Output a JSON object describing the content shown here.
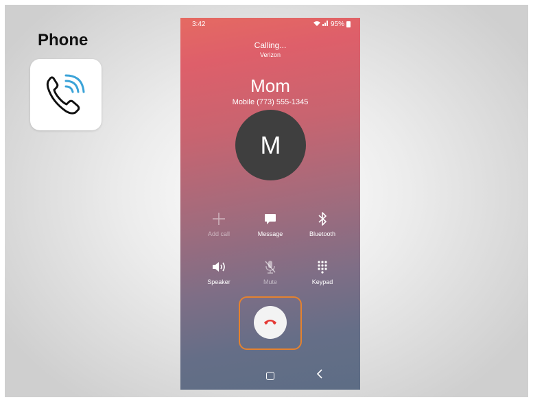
{
  "slide": {
    "title": "Phone"
  },
  "status": {
    "time": "3:42",
    "battery": "95%"
  },
  "call": {
    "state": "Calling...",
    "carrier": "Verizon",
    "contact_name": "Mom",
    "number_label": "Mobile  (773) 555-1345",
    "avatar_initial": "M"
  },
  "actions": {
    "add_call": "Add call",
    "message": "Message",
    "bluetooth": "Bluetooth",
    "speaker": "Speaker",
    "mute": "Mute",
    "keypad": "Keypad"
  },
  "colors": {
    "end_call_red": "#e53935",
    "highlight_orange": "#e5822e"
  },
  "icons": {
    "app": "phone-ringing-icon",
    "add_call": "plus-icon",
    "message": "message-bubble-icon",
    "bluetooth": "bluetooth-icon",
    "speaker": "speaker-icon",
    "mute": "mic-off-icon",
    "keypad": "keypad-icon",
    "end_call": "end-call-icon"
  }
}
